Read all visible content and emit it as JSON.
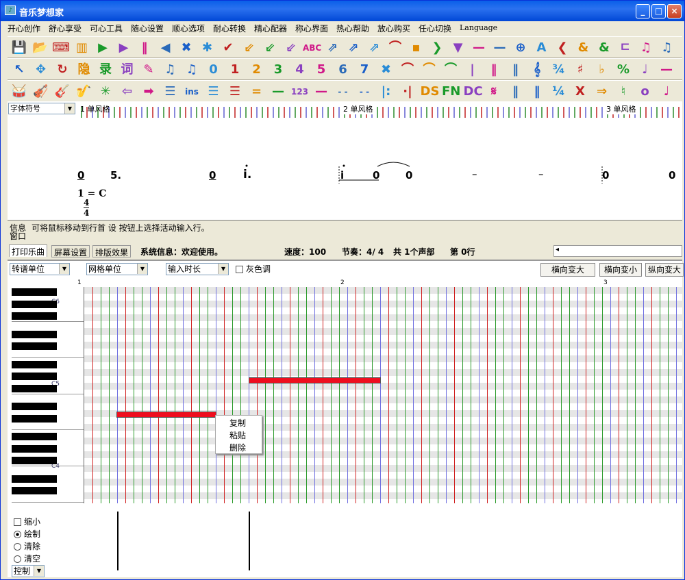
{
  "window": {
    "title": "音乐梦想家",
    "minimize": "_",
    "maximize": "□",
    "close": "×"
  },
  "menu": [
    "开心创作",
    "舒心享受",
    "可心工具",
    "随心设置",
    "顺心选项",
    "耐心转换",
    "精心配器",
    "称心界面",
    "热心帮助",
    "放心购买",
    "任心切换",
    "Language"
  ],
  "toolbar1": [
    "💾",
    "📂",
    "⌨",
    "▥",
    "▶",
    "▶",
    "‖",
    "◀",
    "✖",
    "✱",
    "✔",
    "⇙",
    "⇙",
    "⇙",
    "ABC",
    "⇗",
    "⇗",
    "⇗",
    "⌒",
    "▪",
    "❯",
    "▼",
    "—",
    "—",
    "⊕",
    "A",
    "❮",
    "&",
    "&",
    "ㄷ",
    "♫",
    "♫"
  ],
  "toolbar2": [
    "↖",
    "✥",
    "↻",
    "隐",
    "录",
    "词",
    "✎",
    "♫",
    "♫",
    "0",
    "1",
    "2",
    "3",
    "4",
    "5",
    "6",
    "7",
    "✖",
    "⌒",
    "⌒",
    "⌒",
    "|",
    "‖",
    "‖",
    "𝄞",
    "¾",
    "♯",
    "♭",
    "%",
    "♩",
    "—"
  ],
  "toolbar3": [
    "🥁",
    "🎻",
    "🎸",
    "🎷",
    "✳",
    "⇦",
    "➡",
    "☰",
    "ins",
    "☰",
    "☰",
    "=",
    "—",
    "123",
    "—",
    "- -",
    "- -",
    "|:",
    "·|",
    "DS",
    "FN",
    "DC",
    "𝄋",
    "‖",
    "‖",
    "¼",
    "X",
    "⇒",
    "♮",
    "o",
    "♩"
  ],
  "columns": {
    "font_select": "字体符号",
    "measures": [
      "1 单风格",
      "2 单风格",
      "3 单风格"
    ]
  },
  "score": {
    "notes": [
      "0",
      "5.",
      "0",
      "i.",
      "i",
      "0",
      "0",
      "–",
      "–",
      "0",
      "0"
    ],
    "key": "1 = C",
    "time_top": "4",
    "time_bottom": "4"
  },
  "info": {
    "label1": "信息",
    "text": "可将鼠标移动到行首 设 按钮上选择活动输入行。",
    "label2": "窗口"
  },
  "status": {
    "tab1": "打印乐曲",
    "tab2": "屏幕设置",
    "tab3": "排版效果",
    "sys": "系统信息：欢迎使用。",
    "speed": "速度：100",
    "meter": "节奏：4/ 4",
    "voices": "共 1个声部",
    "line": "第 0行"
  },
  "piano_tools": {
    "sel1": "转谱单位",
    "sel2": "网格单位",
    "sel3": "输入时长",
    "gray": "灰色调",
    "btn1": "横向变大",
    "btn2": "横向变小",
    "btn3": "纵向变大",
    "measures": [
      "1",
      "2",
      "3"
    ],
    "keys": [
      "C6",
      "C5",
      "C4"
    ]
  },
  "context_menu": [
    "复制",
    "粘贴",
    "删除"
  ],
  "bottom": {
    "zoom": "缩小",
    "draw": "绘制",
    "erase": "清除",
    "clear": "清空",
    "control": "控制"
  },
  "colors": {
    "note": "#ef0d1e",
    "accent": "#0a5fe8"
  }
}
